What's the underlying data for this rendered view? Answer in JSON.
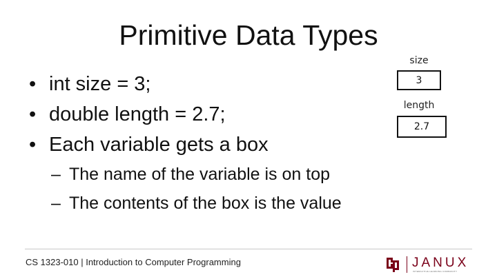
{
  "slide": {
    "title": "Primitive Data Types",
    "bullets": [
      "int size = 3;",
      "double length = 2.7;",
      "Each variable gets a box"
    ],
    "sub_bullets": [
      "The name of the variable is on top",
      "The contents of the box is the value"
    ],
    "bullet_glyph": "•",
    "sub_bullet_glyph": "–"
  },
  "variables": [
    {
      "name": "size",
      "value": "3"
    },
    {
      "name": "length",
      "value": "2.7"
    }
  ],
  "footer": {
    "course": "CS 1323-010 | Introduction to Computer Programming",
    "brand": "JANUX",
    "brand_tagline": "INTERACTIVE LEARNING COMMUNITY"
  },
  "colors": {
    "accent": "#7a0019",
    "text": "#111111",
    "rule": "#c8c8c8"
  }
}
